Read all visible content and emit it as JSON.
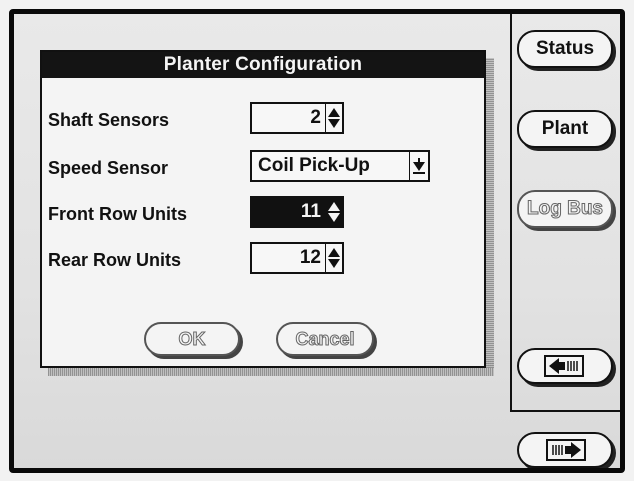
{
  "dialog": {
    "title": "Planter Configuration",
    "fields": [
      {
        "label": "Shaft Sensors",
        "value": "2",
        "type": "spinner"
      },
      {
        "label": "Speed Sensor",
        "value": "Coil Pick-Up",
        "type": "dropdown"
      },
      {
        "label": "Front Row Units",
        "value": "11",
        "type": "spinner",
        "selected": true
      },
      {
        "label": "Rear Row Units",
        "value": "12",
        "type": "spinner"
      }
    ],
    "ok_label": "OK",
    "cancel_label": "Cancel"
  },
  "sidebar": {
    "status_label": "Status",
    "plant_label": "Plant",
    "logbus_label": "Log Bus",
    "prev_icon": "arrow-left-icon",
    "next_icon": "arrow-right-icon"
  }
}
